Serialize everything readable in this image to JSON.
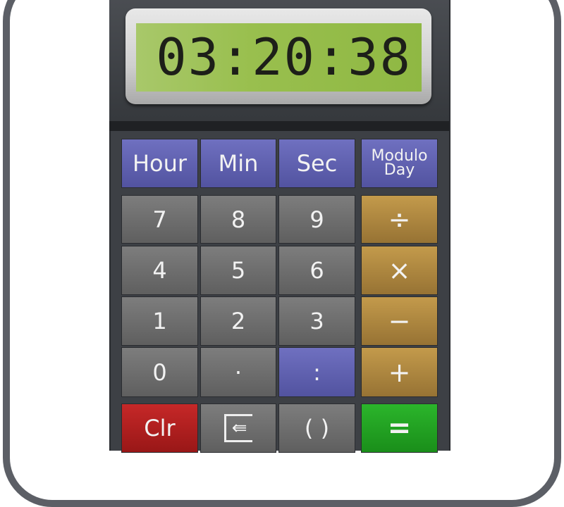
{
  "display": {
    "value": "03:20:38"
  },
  "buttons": {
    "hour": "Hour",
    "min": "Min",
    "sec": "Sec",
    "modulo_day_1": "Modulo",
    "modulo_day_2": "Day",
    "seven": "7",
    "eight": "8",
    "nine": "9",
    "divide": "÷",
    "four": "4",
    "five": "5",
    "six": "6",
    "multiply": "×",
    "one": "1",
    "two": "2",
    "three": "3",
    "minus": "−",
    "zero": "0",
    "dot": "·",
    "colon": ":",
    "plus": "+",
    "clear": "Clr",
    "backspace": "⇚",
    "parens": "( )",
    "equals": "="
  },
  "colors": {
    "lcd": "#99bf4e",
    "unit_buttons": "#6061b0",
    "operator_buttons": "#b08a42",
    "clear": "#b52020",
    "equals": "#22a322"
  }
}
